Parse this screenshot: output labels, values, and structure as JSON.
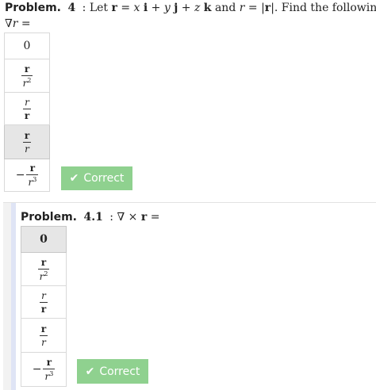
{
  "problem1": {
    "label": "Problem.",
    "number": "4",
    "statement": ": Let r = x i + y j + z k and r = |r|. Find the following.",
    "prompt": "∇r =",
    "options": [
      "0",
      "r / r^2",
      "r / r",
      "r / r",
      "− r / r^3"
    ],
    "selected_index": 3,
    "feedback": "Correct"
  },
  "problem2": {
    "label": "Problem.",
    "number": "4.1",
    "statement": ": ∇ × r =",
    "options": [
      "0",
      "r / r^2",
      "r / r",
      "r / r",
      "− r / r^3"
    ],
    "selected_index": 0,
    "feedback": "Correct"
  },
  "colors": {
    "correct_button": "#8fd18f",
    "selected_option": "#e6e6e6",
    "panel_accent": "#dfe4f5"
  },
  "icons": {
    "check": "checkmark-icon"
  }
}
